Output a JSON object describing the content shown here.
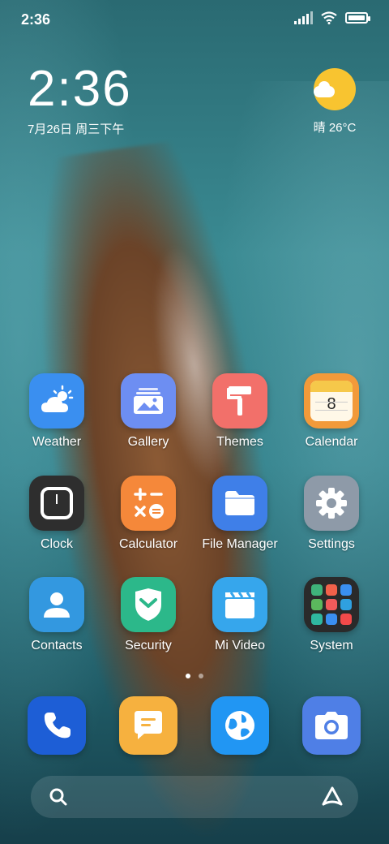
{
  "status_bar": {
    "time": "2:36"
  },
  "clock_widget": {
    "time": "2:36",
    "date": "7月26日 周三下午"
  },
  "weather_widget": {
    "text": "晴 26°C"
  },
  "apps": [
    {
      "label": "Weather",
      "icon": "weather-icon",
      "color": "#3a8ff0"
    },
    {
      "label": "Gallery",
      "icon": "gallery-icon",
      "color": "#6d8ef2"
    },
    {
      "label": "Themes",
      "icon": "themes-icon",
      "color": "#f2706a"
    },
    {
      "label": "Calendar",
      "icon": "calendar-icon",
      "color": "#f29a3a"
    },
    {
      "label": "Clock",
      "icon": "clock-icon",
      "color": "#2e2e2e"
    },
    {
      "label": "Calculator",
      "icon": "calculator-icon",
      "color": "#f5883a"
    },
    {
      "label": "File Manager",
      "icon": "folder-icon",
      "color": "#3f7fe8"
    },
    {
      "label": "Settings",
      "icon": "gear-icon",
      "color": "#8e9aa8"
    },
    {
      "label": "Contacts",
      "icon": "contacts-icon",
      "color": "#3398e0"
    },
    {
      "label": "Security",
      "icon": "shield-icon",
      "color": "#2cb88a"
    },
    {
      "label": "Mi Video",
      "icon": "video-icon",
      "color": "#36a6ec"
    },
    {
      "label": "System",
      "icon": "folder-grid-icon",
      "color": "#2a2a2a"
    }
  ],
  "calendar_day": "8",
  "dock": [
    {
      "name": "phone",
      "icon": "phone-icon",
      "color": "#1d5ed6"
    },
    {
      "name": "messages",
      "icon": "message-icon",
      "color": "#f6b13f"
    },
    {
      "name": "browser",
      "icon": "globe-icon",
      "color": "#2196f3"
    },
    {
      "name": "camera",
      "icon": "camera-icon",
      "color": "#4f7fe6"
    }
  ]
}
